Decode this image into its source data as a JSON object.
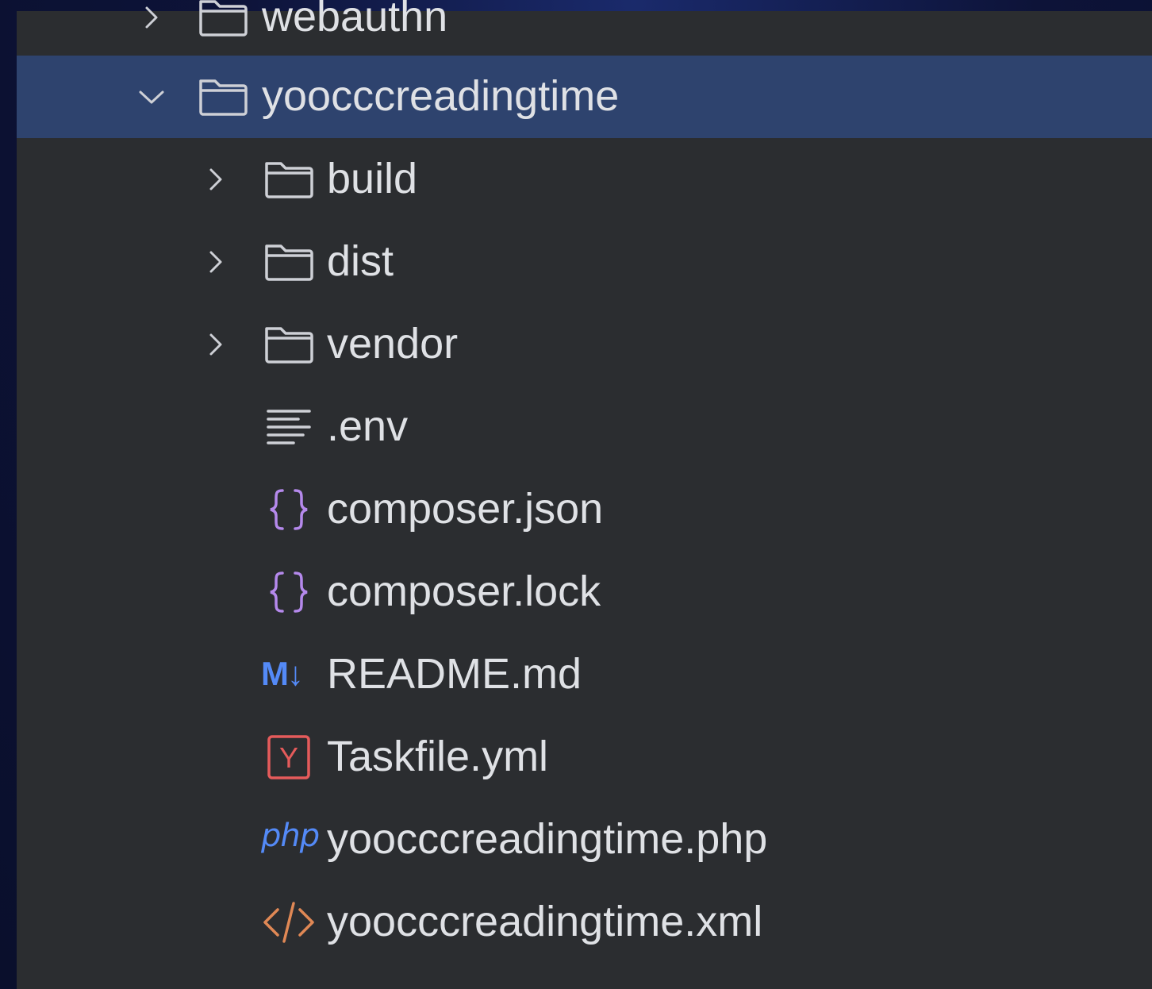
{
  "tree": {
    "items": [
      {
        "label": "webauthn",
        "type": "folder",
        "depth": 0,
        "expanded": false,
        "selected": false,
        "icon": "folder-icon"
      },
      {
        "label": "yoocccreadingtime",
        "type": "folder",
        "depth": 0,
        "expanded": true,
        "selected": true,
        "icon": "folder-icon"
      },
      {
        "label": "build",
        "type": "folder",
        "depth": 1,
        "expanded": false,
        "selected": false,
        "icon": "folder-icon"
      },
      {
        "label": "dist",
        "type": "folder",
        "depth": 1,
        "expanded": false,
        "selected": false,
        "icon": "folder-icon"
      },
      {
        "label": "vendor",
        "type": "folder",
        "depth": 1,
        "expanded": false,
        "selected": false,
        "icon": "folder-icon"
      },
      {
        "label": ".env",
        "type": "file",
        "depth": 1,
        "selected": false,
        "icon": "text-file-icon"
      },
      {
        "label": "composer.json",
        "type": "file",
        "depth": 1,
        "selected": false,
        "icon": "json-icon"
      },
      {
        "label": "composer.lock",
        "type": "file",
        "depth": 1,
        "selected": false,
        "icon": "json-icon"
      },
      {
        "label": "README.md",
        "type": "file",
        "depth": 1,
        "selected": false,
        "icon": "markdown-icon",
        "icon_text": "M↓"
      },
      {
        "label": "Taskfile.yml",
        "type": "file",
        "depth": 1,
        "selected": false,
        "icon": "yaml-icon",
        "icon_text": "Y"
      },
      {
        "label": "yoocccreadingtime.php",
        "type": "file",
        "depth": 1,
        "selected": false,
        "icon": "php-icon",
        "icon_text": "php"
      },
      {
        "label": "yoocccreadingtime.xml",
        "type": "file",
        "depth": 1,
        "selected": false,
        "icon": "xml-icon"
      }
    ]
  },
  "colors": {
    "panel_bg": "#2b2d30",
    "selection_bg": "#2e436e",
    "text": "#dfe1e5",
    "folder_stroke": "#ced0d6",
    "json_icon": "#b589ec",
    "markdown_icon": "#548af7",
    "yaml_icon": "#e55b5b",
    "php_icon": "#548af7",
    "xml_icon": "#e08855"
  }
}
